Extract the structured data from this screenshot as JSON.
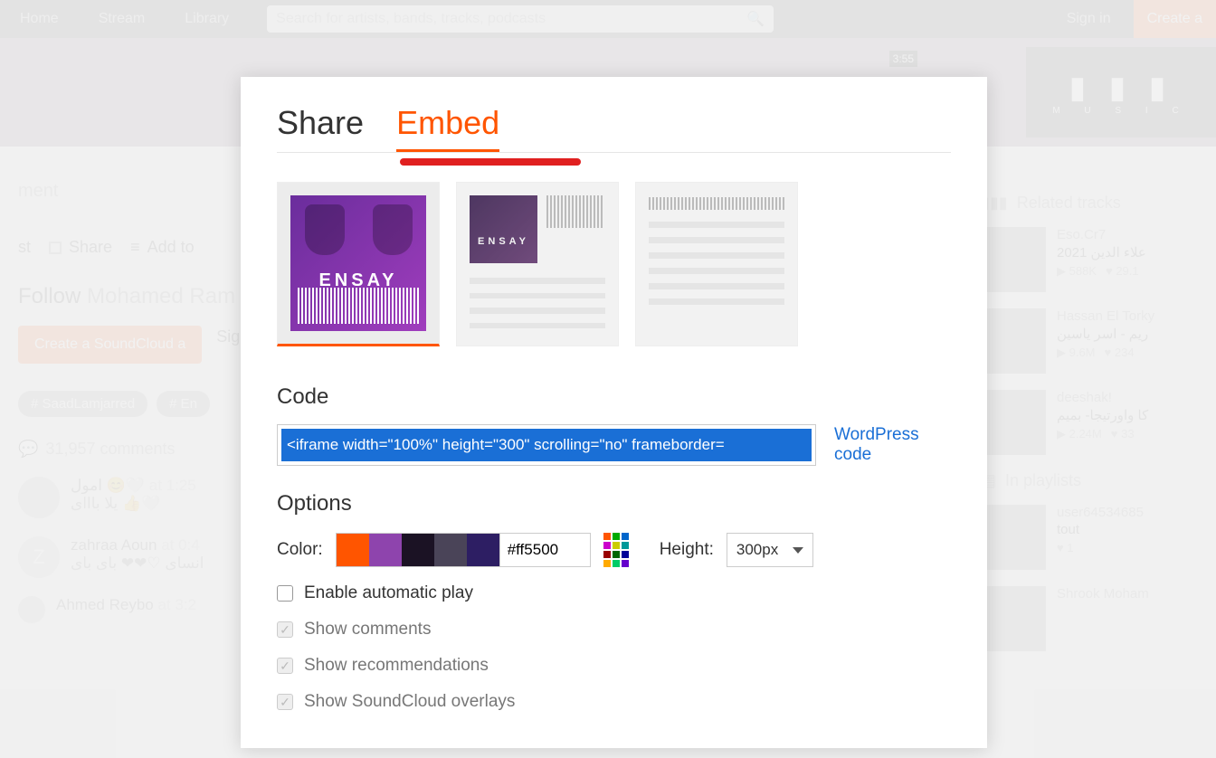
{
  "nav": {
    "home": "Home",
    "stream": "Stream",
    "library": "Library",
    "search_placeholder": "Search for artists, bands, tracks, podcasts",
    "signin": "Sign in",
    "create": "Create a"
  },
  "wave": {
    "duration": "3:55",
    "logo_line": "M U S I C"
  },
  "left": {
    "ment": "ment",
    "st": "st",
    "share": "Share",
    "addto": "Add to",
    "follow_pre": "Follow ",
    "follow_who": "Mohamed Ram",
    "create_btn": "Create a SoundCloud a",
    "signin": "Sign in",
    "tag1": "# SaadLamjarred",
    "tag2": "# En",
    "comments": "31,957 comments",
    "c1_name": "امول 😊🤍",
    "c1_at": "at 1:25",
    "c1_txt": "يلا بااای 👍🤍",
    "c2_name": "zahraa Aoun",
    "c2_at": "at 0:4",
    "c2_txt": "انساى ♡❤❤ بای بای",
    "c2_avatar": "Z",
    "c3_name": "Ahmed Reybo",
    "c3_at": "at 3:2"
  },
  "right": {
    "related": "Related tracks",
    "inpl": "In playlists",
    "tracks": [
      {
        "artist": "Eso.Cr7",
        "title": "علاء الدين 2021",
        "plays": "588K",
        "likes": "29.1"
      },
      {
        "artist": "Hassan El Torky",
        "title": "ريم - اسر ياسين",
        "plays": "9.6M",
        "likes": "234"
      },
      {
        "artist": "deeshak!",
        "title": "كا واورتيجا- بميم",
        "plays": "2.24M",
        "likes": "33"
      }
    ],
    "pl": [
      {
        "artist": "user64534685",
        "title": "tout",
        "likes": "1"
      },
      {
        "artist": "Shrook Moham",
        "title": ""
      }
    ]
  },
  "modal": {
    "tab_share": "Share",
    "tab_embed": "Embed",
    "art_title": "ENSAY",
    "code_h": "Code",
    "code_val": "<iframe width=\"100%\" height=\"300\" scrolling=\"no\" frameborder=",
    "wp": "WordPress code",
    "options_h": "Options",
    "color_lbl": "Color:",
    "swatches": [
      "#ff5500",
      "#8e44ad",
      "#1b1224",
      "#4a4458",
      "#2d1e63"
    ],
    "hex": "#ff5500",
    "height_lbl": "Height:",
    "height_val": "300px",
    "opt1": "Enable automatic play",
    "opt2": "Show comments",
    "opt3": "Show recommendations",
    "opt4": "Show SoundCloud overlays"
  }
}
